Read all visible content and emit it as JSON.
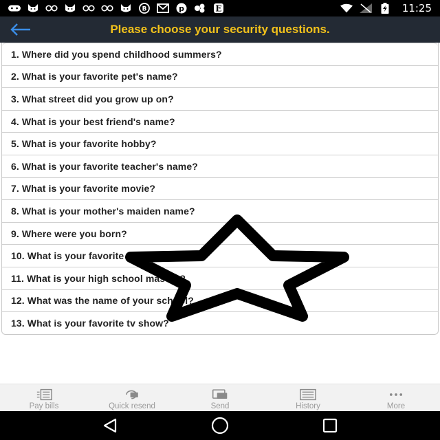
{
  "status_bar": {
    "time": "11:25",
    "notification_icons": [
      "game-pad-icon",
      "glasses-icon",
      "cat-icon",
      "glasses-icon",
      "glasses-icon",
      "cat-icon",
      "bitmoji-icon",
      "gmail-icon",
      "pinterest-icon",
      "cluster-icon",
      "e-icon"
    ]
  },
  "header": {
    "title": "Please choose your security questions."
  },
  "questions": [
    "1. Where did you spend childhood summers?",
    "2. What is your favorite pet's name?",
    "3. What street did you grow up on?",
    "4. What is your best friend's name?",
    "5. What is your favorite hobby?",
    "6. What is your favorite teacher's name?",
    "7. What is your favorite movie?",
    "8. What is your mother's maiden name?",
    "9. Where were you born?",
    "10. What is your favorite food?",
    "11. What is your high school mascot?",
    "12. What was the name of your school?",
    "13. What is your favorite tv show?"
  ],
  "tabs": [
    {
      "label": "Pay bills",
      "icon": "bill-icon"
    },
    {
      "label": "Quick resend",
      "icon": "quick-resend-icon"
    },
    {
      "label": "Send",
      "icon": "send-icon"
    },
    {
      "label": "History",
      "icon": "history-icon"
    },
    {
      "label": "More",
      "icon": "more-icon"
    }
  ],
  "colors": {
    "header_bg": "#232a34",
    "header_title": "#f3c21b",
    "back_arrow": "#3b8ee8"
  }
}
